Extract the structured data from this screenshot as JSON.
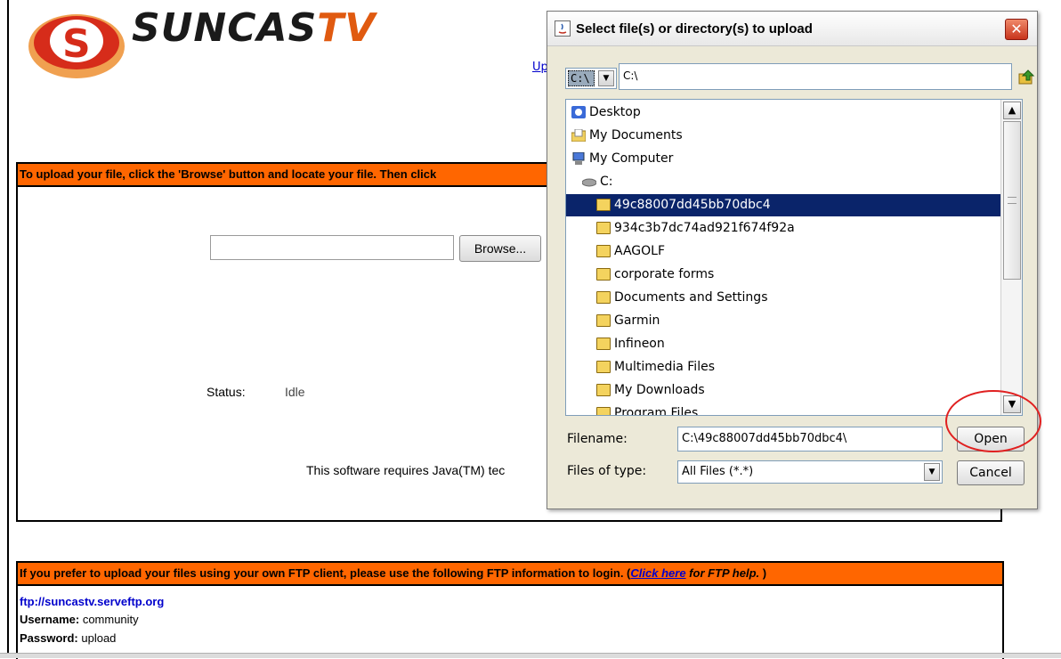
{
  "page": {
    "logo_text_main": "SUNCAS",
    "logo_text_tv": "TV",
    "upload_link": "Upl",
    "upload_header": "To upload your file, click the 'Browse' button and locate your file. Then click",
    "browse_label": "Browse...",
    "status_label": "Status:",
    "status_value": "Idle",
    "java_note": "This software requires Java(TM) tec",
    "ftp": {
      "header_text": "If you prefer to upload your files using your own FTP client, please use the following FTP information to login. (",
      "help_link": "Click here",
      "help_tail": " for FTP help.",
      "header_close": " )",
      "url": "ftp://suncastv.serveftp.org",
      "username_key": "Username:",
      "username_value": " community",
      "password_key": "Password:",
      "password_value": " upload"
    }
  },
  "dialog": {
    "title": "Select file(s) or directory(s) to upload",
    "close_glyph": "✕",
    "drive_value": "C:\\",
    "drive_arrow": "▼",
    "path_value": "C:\\",
    "items": [
      {
        "label": "Desktop",
        "icon": "desktop-icon"
      },
      {
        "label": "My Documents",
        "icon": "my-documents-icon"
      },
      {
        "label": "My Computer",
        "icon": "my-computer-icon"
      },
      {
        "label": "C:",
        "icon": "drive-icon"
      },
      {
        "label": "49c88007dd45bb70dbc4",
        "icon": "folder-icon",
        "selected": true
      },
      {
        "label": "934c3b7dc74ad921f674f92a",
        "icon": "folder-icon"
      },
      {
        "label": "AAGOLF",
        "icon": "folder-icon"
      },
      {
        "label": "corporate forms",
        "icon": "folder-icon"
      },
      {
        "label": "Documents and Settings",
        "icon": "folder-icon"
      },
      {
        "label": "Garmin",
        "icon": "folder-icon"
      },
      {
        "label": "Infineon",
        "icon": "folder-icon"
      },
      {
        "label": "Multimedia Files",
        "icon": "folder-icon"
      },
      {
        "label": "My Downloads",
        "icon": "folder-icon"
      },
      {
        "label": "Program Files",
        "icon": "folder-icon"
      }
    ],
    "scroll_up_glyph": "▲",
    "scroll_down_glyph": "▼",
    "filename_label": "Filename:",
    "filename_value": "C:\\49c88007dd45bb70dbc4\\",
    "open_label": "Open",
    "types_label": "Files of type:",
    "types_value": "All Files (*.*)",
    "types_arrow": "▼",
    "cancel_label": "Cancel"
  },
  "colors": {
    "header_orange": "#ff6600",
    "selection_blue": "#0a246a",
    "annotation_red": "#e02020",
    "link_blue": "#0000cc"
  }
}
